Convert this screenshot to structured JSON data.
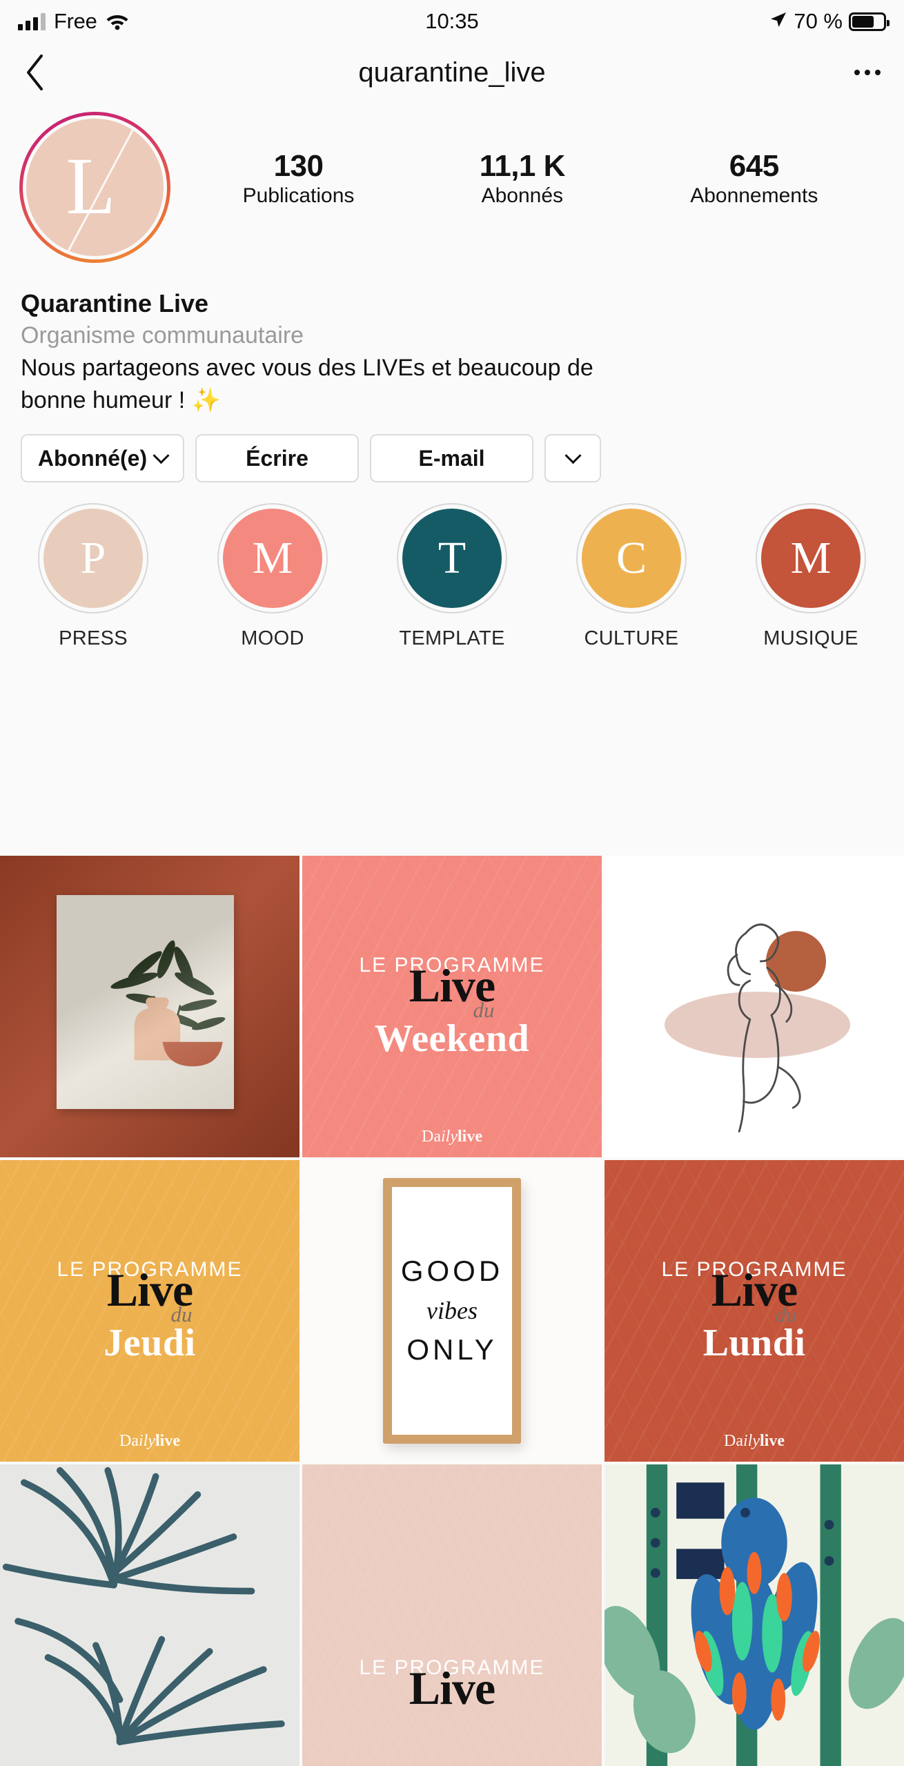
{
  "status_bar": {
    "carrier": "Free",
    "time": "10:35",
    "battery_percent": "70 %",
    "signal_icon": "cellular-bars-icon",
    "wifi_icon": "wifi-icon",
    "location_icon": "location-arrow-icon",
    "battery_icon": "battery-icon"
  },
  "nav": {
    "back_icon": "back-chevron-icon",
    "title": "quarantine_live",
    "more_icon": "more-options-icon"
  },
  "profile": {
    "avatar_letter": "L",
    "avatar_bg": "#eccbba",
    "ring_colors": [
      "#c21a7a",
      "#e8633f",
      "#f0922f"
    ],
    "stats": [
      {
        "number": "130",
        "label": "Publications"
      },
      {
        "number": "11,1 K",
        "label": "Abonnés"
      },
      {
        "number": "645",
        "label": "Abonnements"
      }
    ],
    "display_name": "Quarantine Live",
    "category": "Organisme communautaire",
    "bio_line_1": "Nous partageons avec vous des LIVEs et beaucoup de",
    "bio_line_2": "bonne humeur ! ✨"
  },
  "actions": {
    "follow_label": "Abonné(e)",
    "follow_chevron_icon": "chevron-down-icon",
    "message_label": "Écrire",
    "email_label": "E-mail",
    "more_chevron_icon": "chevron-down-icon"
  },
  "highlights": [
    {
      "letter": "P",
      "label": "PRESS",
      "color": "#e8cdbc"
    },
    {
      "letter": "M",
      "label": "MOOD",
      "color": "#f4897f"
    },
    {
      "letter": "T",
      "label": "TEMPLATE",
      "color": "#155b66"
    },
    {
      "letter": "C",
      "label": "CULTURE",
      "color": "#eeb14f"
    },
    {
      "letter": "M",
      "label": "MUSIQUE",
      "color": "#c4543a"
    }
  ],
  "posts": [
    {
      "type": "wall-poster",
      "name": "post-plant-poster",
      "bg": "#a8462b",
      "alt": "Affiche botanique sur mur terracotta"
    },
    {
      "type": "programme",
      "name": "post-live-weekend",
      "bg": "#f4897f",
      "top": "LE PROGRAMME",
      "live": "Live",
      "du": "du",
      "day": "Weekend",
      "watermark_a": "Da",
      "watermark_b": "ily",
      "watermark_c": "live"
    },
    {
      "type": "lineart",
      "name": "post-line-art-figure",
      "bg": "#ffffff",
      "alt": "Illustration au trait d'une silhouette"
    },
    {
      "type": "programme",
      "name": "post-live-jeudi",
      "bg": "#eeb14f",
      "top": "LE PROGRAMME",
      "live": "Live",
      "du": "du",
      "day": "Jeudi",
      "watermark_a": "Da",
      "watermark_b": "ily",
      "watermark_c": "live"
    },
    {
      "type": "frame-quote",
      "name": "post-good-vibes-only",
      "bg": "#fcfbf9",
      "line1": "GOOD",
      "line2": "vibes",
      "line3": "ONLY"
    },
    {
      "type": "programme",
      "name": "post-live-lundi",
      "bg": "#c4543a",
      "top": "LE PROGRAMME",
      "live": "Live",
      "du": "du",
      "day": "Lundi",
      "watermark_a": "Da",
      "watermark_b": "ily",
      "watermark_c": "live"
    },
    {
      "type": "fabric",
      "name": "post-palm-fabric",
      "bg": "#e7e8e5",
      "alt": "Tissu motif feuilles de palmier bleu"
    },
    {
      "type": "programme-partial",
      "name": "post-live-partial",
      "bg": "#eccdc1",
      "top": "LE PROGRAMME",
      "live": "Live"
    },
    {
      "type": "tropic",
      "name": "post-tropical-illustration",
      "bg": "#f2f3e8",
      "alt": "Illustration tropicale colorée"
    }
  ]
}
